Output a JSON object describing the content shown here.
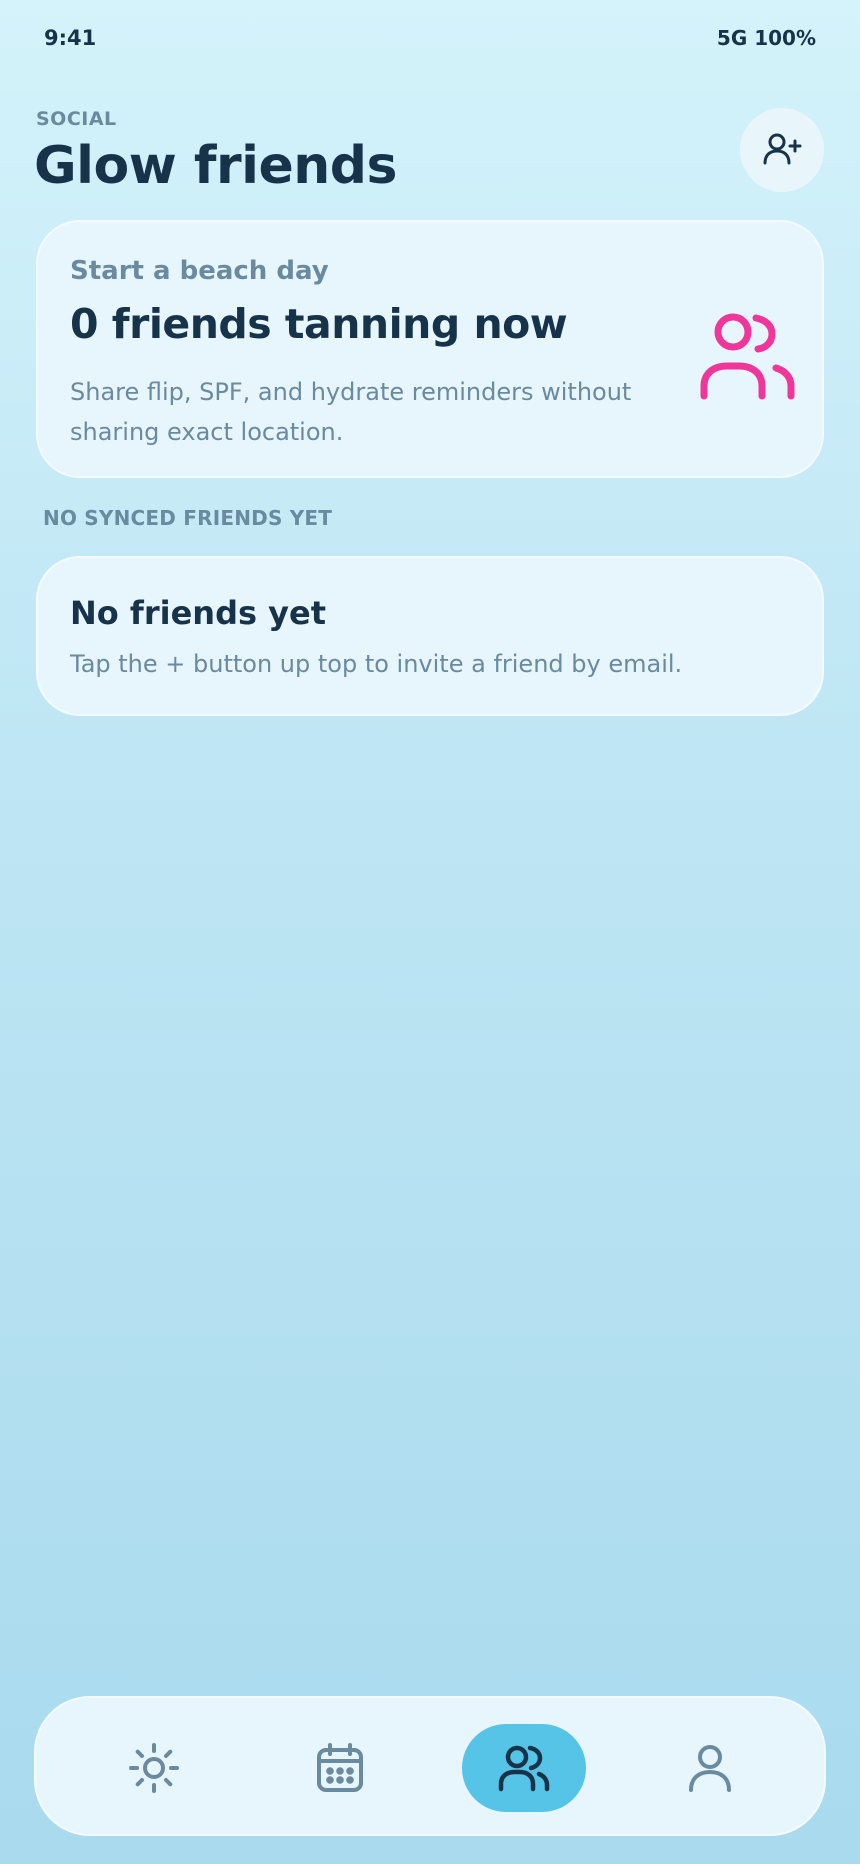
{
  "status_bar": {
    "time": "9:41",
    "right": "5G 100%"
  },
  "header": {
    "eyebrow": "SOCIAL",
    "title": "Glow friends",
    "add_friend_icon": "user-plus-icon"
  },
  "hero_card": {
    "eyebrow": "Start a beach day",
    "title": "0 friends tanning now",
    "subtitle": "Share flip, SPF, and hydrate reminders without sharing exact location.",
    "icon": "users-icon",
    "icon_color": "#f0369a"
  },
  "section": {
    "label": "NO SYNCED FRIENDS YET"
  },
  "empty_card": {
    "title": "No friends yet",
    "subtitle": "Tap the + button up top to invite a friend by email."
  },
  "tab_bar": {
    "tabs": [
      {
        "icon": "sun-icon",
        "active": false
      },
      {
        "icon": "calendar-icon",
        "active": false
      },
      {
        "icon": "users-icon",
        "active": true
      },
      {
        "icon": "user-icon",
        "active": false
      }
    ],
    "active_color": "#55c4e6"
  },
  "colors": {
    "text_primary": "#17334a",
    "text_secondary": "#6a8aa0",
    "card_bg": "#e7f5fc",
    "accent_pink": "#f0369a"
  }
}
